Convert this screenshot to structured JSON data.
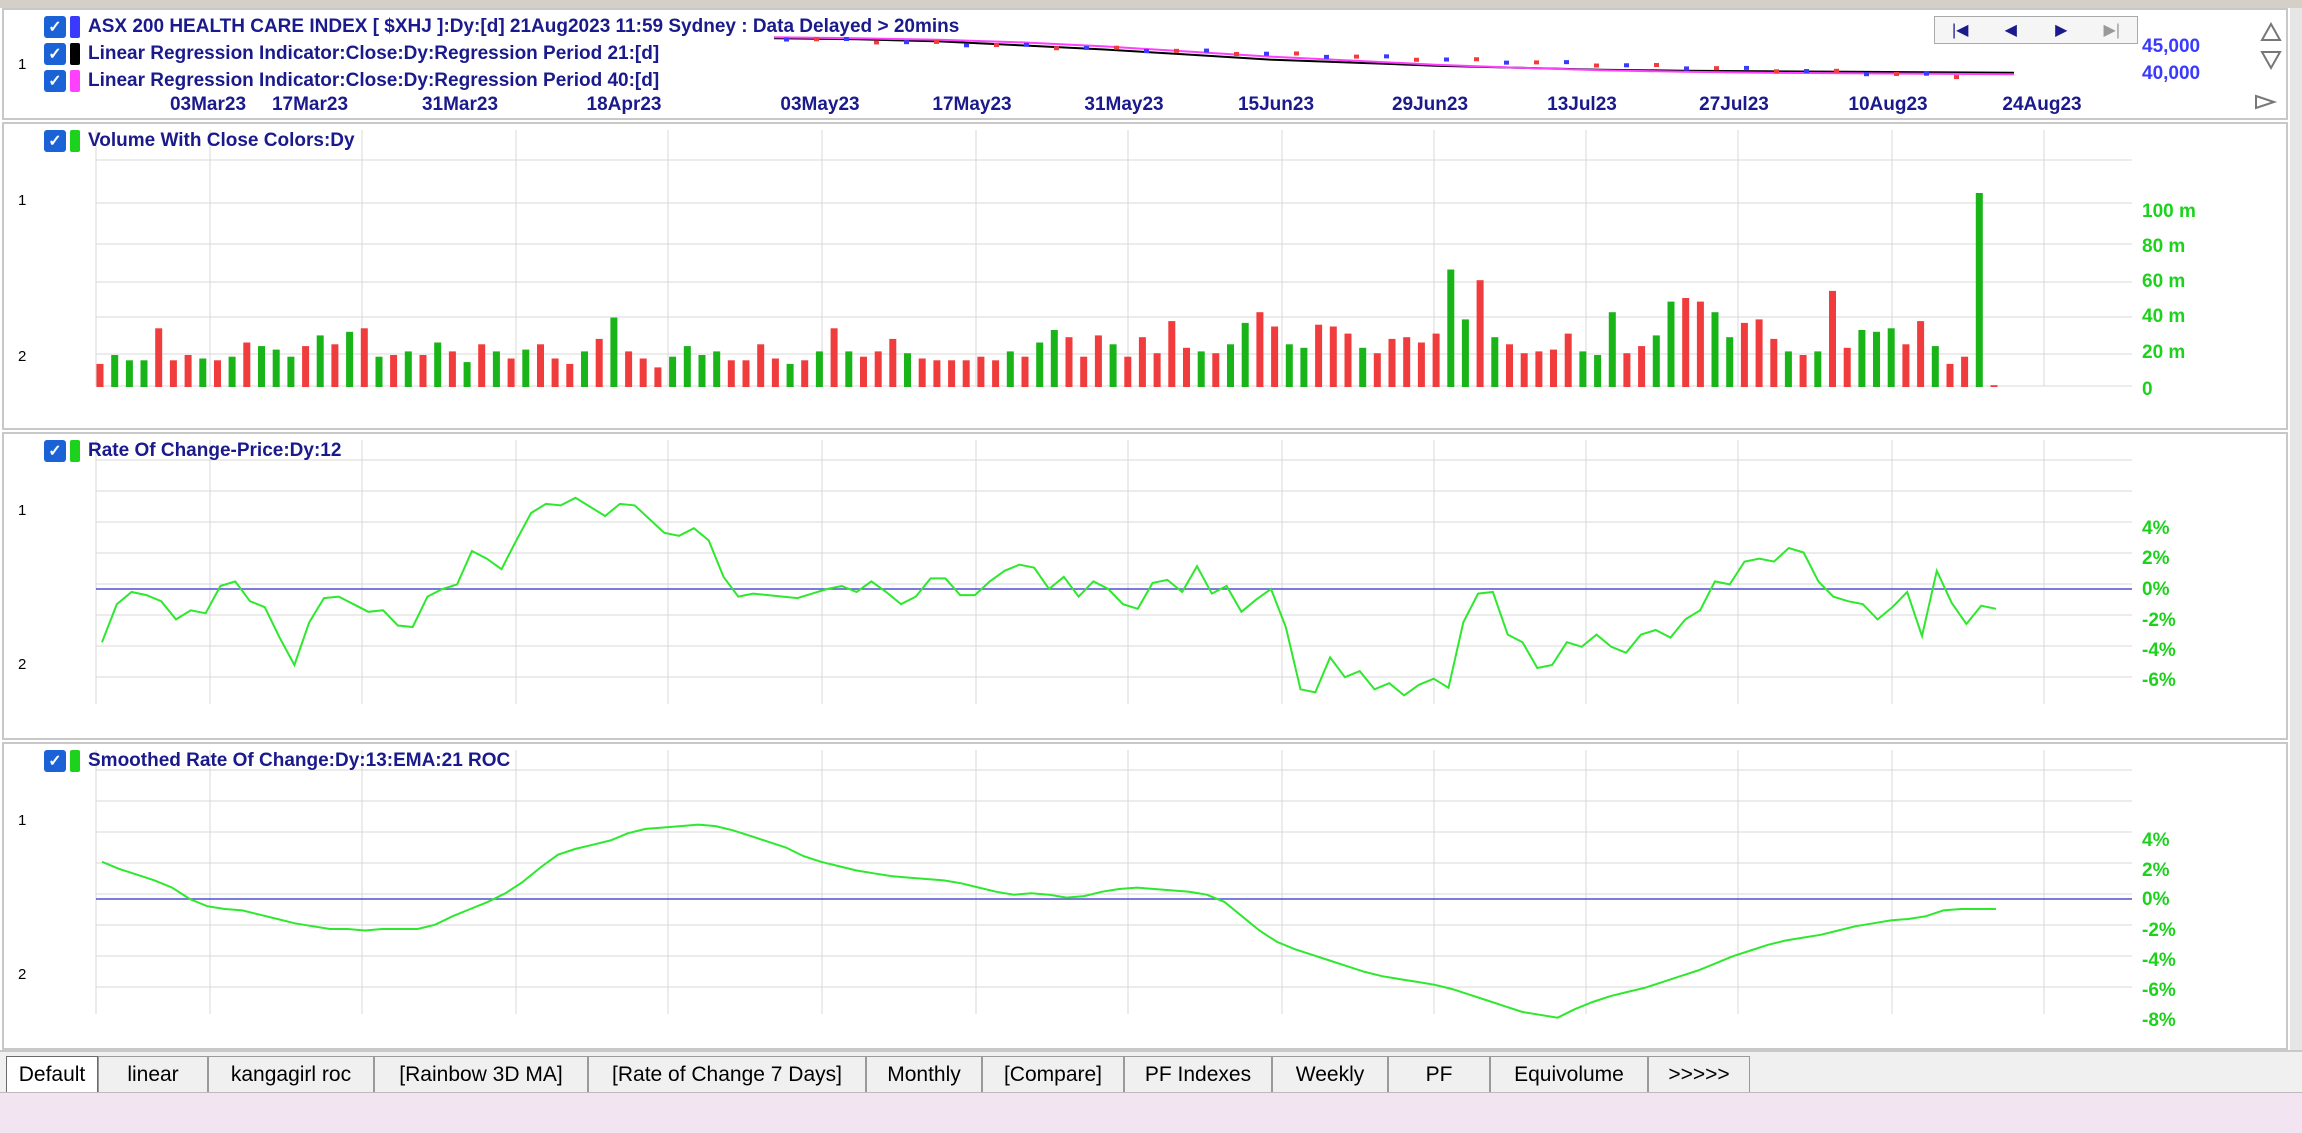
{
  "colors": {
    "axis_blue": "#1a1a8c",
    "scale_green": "#1cd21c",
    "price_blue": "#3a3aff",
    "up_green": "#18b418",
    "down_red": "#f03c3c",
    "reg21": "#000000",
    "reg40": "#ff40ff",
    "zero_line": "#5050d0",
    "grid": "#d8d8d8"
  },
  "price_pane": {
    "legend": [
      {
        "text": "ASX 200 HEALTH CARE INDEX [ $XHJ ]:Dy:[d]  21Aug2023 11:59  Sydney : Data Delayed > 20mins",
        "color": "#3a3aff"
      },
      {
        "text": "Linear Regression Indicator:Close:Dy:Regression Period 21:[d]",
        "color": "#000000"
      },
      {
        "text": "Linear Regression Indicator:Close:Dy:Regression Period 40:[d]",
        "color": "#ff40ff"
      }
    ],
    "row_label": "1",
    "y_scale": [
      "45,000",
      "40,000"
    ],
    "date_labels": [
      "03Mar23",
      "17Mar23",
      "31Mar23",
      "18Apr23",
      "03May23",
      "17May23",
      "31May23",
      "15Jun23",
      "29Jun23",
      "13Jul23",
      "27Jul23",
      "10Aug23",
      "24Aug23"
    ],
    "nav_icons": [
      "first-icon",
      "prev-icon",
      "next-icon",
      "last-icon"
    ]
  },
  "volume_pane": {
    "legend": "Volume With Close Colors:Dy",
    "row_labels": [
      "1",
      "2"
    ],
    "y_scale": [
      "100 m",
      "80 m",
      "60 m",
      "40 m",
      "20 m",
      "0"
    ]
  },
  "roc_pane": {
    "legend": "Rate Of Change-Price:Dy:12",
    "row_labels": [
      "1",
      "2"
    ],
    "y_scale": [
      "4%",
      "2%",
      "0%",
      "-2%",
      "-4%",
      "-6%"
    ]
  },
  "sroc_pane": {
    "legend": "Smoothed Rate Of Change:Dy:13:EMA:21 ROC",
    "row_labels": [
      "1",
      "2"
    ],
    "y_scale": [
      "4%",
      "2%",
      "0%",
      "-2%",
      "-4%",
      "-6%",
      "-8%"
    ]
  },
  "tabs": [
    "Default",
    "linear",
    "kangagirl roc",
    "[Rainbow 3D MA]",
    "[Rate of Change 7 Days]",
    "Monthly",
    "[Compare]",
    "PF Indexes",
    "Weekly",
    "PF",
    "Equivolume",
    ">>>>>"
  ],
  "active_tab": "Default",
  "chart_data": [
    {
      "type": "line",
      "title": "ASX 200 HEALTH CARE INDEX [ $XHJ ]:Dy:[d]",
      "ylim": [
        38500,
        46000
      ],
      "series": [
        {
          "name": "Linear Regression Indicator:Close:Dy:Regression Period 21:[d]",
          "values": [
            43600,
            43500,
            43300,
            42900,
            42500,
            42000,
            41500,
            41200,
            40900,
            40700,
            40500,
            40400,
            40350,
            40300,
            40250,
            40200
          ]
        },
        {
          "name": "Linear Regression Indicator:Close:Dy:Regression Period 40:[d]",
          "values": [
            43700,
            43600,
            43450,
            43200,
            42800,
            42300,
            41800,
            41400,
            41000,
            40700,
            40450,
            40300,
            40200,
            40150,
            40100,
            40050
          ]
        }
      ]
    },
    {
      "type": "bar",
      "title": "Volume With Close Colors:Dy",
      "ylabel": "",
      "ylim": [
        0,
        120
      ],
      "values": [
        13,
        18,
        15,
        15,
        33,
        15,
        18,
        16,
        15,
        17,
        25,
        23,
        21,
        17,
        23,
        29,
        24,
        31,
        33,
        17,
        18,
        20,
        18,
        25,
        20,
        14,
        24,
        20,
        16,
        21,
        24,
        16,
        13,
        20,
        27,
        39,
        20,
        16,
        11,
        17,
        23,
        18,
        20,
        15,
        15,
        24,
        16,
        13,
        15,
        20,
        33,
        20,
        17,
        20,
        27,
        19,
        16,
        15,
        15,
        15,
        17,
        15,
        20,
        17,
        25,
        32,
        28,
        17,
        29,
        24,
        17,
        28,
        19,
        37,
        22,
        20,
        19,
        24,
        36,
        42,
        34,
        24,
        22,
        35,
        34,
        30,
        22,
        19,
        27,
        28,
        25,
        30,
        66,
        38,
        60,
        28,
        24,
        19,
        20,
        21,
        30,
        20,
        18,
        42,
        19,
        23,
        29,
        48,
        50,
        48,
        42,
        28,
        36,
        38,
        27,
        20,
        18,
        20,
        54,
        22,
        32,
        31,
        33,
        24,
        37,
        23,
        13,
        17,
        109,
        1
      ],
      "colors": [
        "r",
        "g",
        "g",
        "g",
        "r",
        "r",
        "r",
        "g",
        "r",
        "g",
        "r",
        "g",
        "g",
        "g",
        "r",
        "g",
        "r",
        "g",
        "r",
        "g",
        "r",
        "g",
        "r",
        "g",
        "r",
        "g",
        "r",
        "g",
        "r",
        "g",
        "r",
        "r",
        "r",
        "g",
        "r",
        "g",
        "r",
        "r",
        "r",
        "g",
        "g",
        "g",
        "g",
        "r",
        "r",
        "r",
        "r",
        "g",
        "r",
        "g",
        "r",
        "g",
        "r",
        "r",
        "r",
        "g",
        "r",
        "r",
        "r",
        "r",
        "r",
        "r",
        "g",
        "r",
        "g",
        "g",
        "r",
        "r",
        "r",
        "g",
        "r",
        "r",
        "r",
        "r",
        "r",
        "g",
        "r",
        "g",
        "g",
        "r",
        "r",
        "g",
        "g",
        "r",
        "r",
        "r",
        "g",
        "r",
        "r",
        "r",
        "r",
        "r",
        "g",
        "g",
        "r",
        "g",
        "r",
        "r",
        "r",
        "r",
        "r",
        "g",
        "g",
        "g",
        "r",
        "r",
        "g",
        "g",
        "r",
        "r",
        "g",
        "g",
        "r",
        "r",
        "r",
        "g",
        "r",
        "g",
        "r",
        "r",
        "g",
        "g",
        "g",
        "r",
        "r",
        "g",
        "r",
        "r",
        "g",
        "r"
      ]
    },
    {
      "type": "line",
      "title": "Rate Of Change-Price:Dy:12",
      "ylim": [
        -8,
        6
      ],
      "series": [
        {
          "name": "Rate Of Change-Price:Dy:12",
          "values": [
            -3.5,
            -1.0,
            -0.2,
            -0.4,
            -0.8,
            -2.0,
            -1.4,
            -1.6,
            0.2,
            0.5,
            -0.8,
            -1.2,
            -3.2,
            -5.0,
            -2.2,
            -0.6,
            -0.5,
            -1.0,
            -1.5,
            -1.4,
            -2.4,
            -2.5,
            -0.5,
            0.0,
            0.3,
            2.5,
            2.0,
            1.3,
            3.2,
            5.0,
            5.6,
            5.5,
            6.0,
            5.4,
            4.8,
            5.6,
            5.5,
            4.6,
            3.7,
            3.5,
            4.0,
            3.2,
            0.8,
            -0.5,
            -0.3,
            -0.4,
            -0.5,
            -0.6,
            -0.3,
            0.0,
            0.2,
            -0.2,
            0.5,
            -0.2,
            -1.0,
            -0.5,
            0.7,
            0.7,
            -0.4,
            -0.4,
            0.5,
            1.2,
            1.6,
            1.4,
            0.0,
            0.8,
            -0.5,
            0.5,
            0.0,
            -1.0,
            -1.3,
            0.4,
            0.6,
            -0.2,
            1.5,
            -0.3,
            0.2,
            -1.5,
            -0.7,
            0.0,
            -2.5,
            -6.6,
            -6.8,
            -4.5,
            -5.8,
            -5.4,
            -6.6,
            -6.2,
            -7.0,
            -6.3,
            -5.9,
            -6.5,
            -2.2,
            -0.3,
            -0.2,
            -3.0,
            -3.5,
            -5.2,
            -5.0,
            -3.5,
            -3.8,
            -3.0,
            -3.8,
            -4.2,
            -3.0,
            -2.7,
            -3.2,
            -2.0,
            -1.4,
            0.5,
            0.3,
            1.8,
            2.0,
            1.8,
            2.7,
            2.4,
            0.5,
            -0.5,
            -0.8,
            -1.0,
            -2.0,
            -1.2,
            -0.2,
            -3.1,
            1.2,
            -0.9,
            -2.3,
            -1.1,
            -1.3
          ]
        }
      ]
    },
    {
      "type": "line",
      "title": "Smoothed Rate Of Change:Dy:13:EMA:21 ROC",
      "ylim": [
        -9,
        5.5
      ],
      "series": [
        {
          "name": "Smoothed Rate Of Change:Dy:13:EMA:21 ROC",
          "values": [
            2.6,
            2.1,
            1.7,
            1.3,
            0.8,
            0.0,
            -0.5,
            -0.7,
            -0.8,
            -1.1,
            -1.4,
            -1.7,
            -1.9,
            -2.1,
            -2.1,
            -2.2,
            -2.1,
            -2.1,
            -2.1,
            -1.8,
            -1.2,
            -0.7,
            -0.2,
            0.4,
            1.2,
            2.2,
            3.1,
            3.5,
            3.8,
            4.1,
            4.6,
            4.9,
            5.0,
            5.1,
            5.2,
            5.1,
            4.8,
            4.4,
            4.0,
            3.6,
            3.0,
            2.6,
            2.3,
            2.0,
            1.8,
            1.6,
            1.5,
            1.4,
            1.3,
            1.1,
            0.8,
            0.5,
            0.3,
            0.4,
            0.3,
            0.1,
            0.2,
            0.5,
            0.7,
            0.8,
            0.7,
            0.6,
            0.5,
            0.3,
            -0.2,
            -1.2,
            -2.2,
            -3.0,
            -3.5,
            -3.9,
            -4.3,
            -4.7,
            -5.1,
            -5.4,
            -5.6,
            -5.8,
            -6.0,
            -6.3,
            -6.7,
            -7.1,
            -7.5,
            -7.9,
            -8.1,
            -8.3,
            -7.7,
            -7.2,
            -6.8,
            -6.5,
            -6.2,
            -5.8,
            -5.4,
            -5.0,
            -4.5,
            -4.0,
            -3.6,
            -3.2,
            -2.9,
            -2.7,
            -2.5,
            -2.2,
            -1.9,
            -1.7,
            -1.5,
            -1.4,
            -1.2,
            -0.8,
            -0.7,
            -0.7,
            -0.7
          ]
        }
      ]
    }
  ]
}
